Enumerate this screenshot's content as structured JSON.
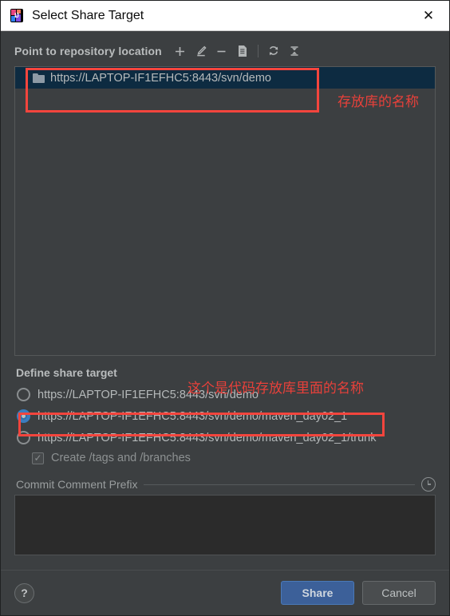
{
  "window": {
    "title": "Select Share Target",
    "app_icon": "intellij-idea-icon",
    "close_label": "✕"
  },
  "repository_section": {
    "label": "Point to repository location",
    "toolbar": [
      {
        "name": "add-location-button",
        "glyph": "+",
        "title": "Add"
      },
      {
        "name": "edit-location-button",
        "glyph": "edit",
        "title": "Edit"
      },
      {
        "name": "remove-location-button",
        "glyph": "−",
        "title": "Remove"
      },
      {
        "name": "copy-location-button",
        "glyph": "copy",
        "title": "Copy"
      },
      {
        "name": "refresh-button",
        "glyph": "refresh",
        "title": "Refresh"
      },
      {
        "name": "collapse-all-button",
        "glyph": "collapse",
        "title": "Collapse All"
      }
    ],
    "tree_items": [
      {
        "label": "https://LAPTOP-IF1EFHC5:8443/svn/demo",
        "icon": "folder-icon",
        "selected": true
      }
    ]
  },
  "share_target": {
    "title": "Define share target",
    "options": [
      {
        "label": "https://LAPTOP-IF1EFHC5:8443/svn/demo",
        "selected": false
      },
      {
        "label": "https://LAPTOP-IF1EFHC5:8443/svn/demo/maven_day02_1",
        "selected": true
      },
      {
        "label": "https://LAPTOP-IF1EFHC5:8443/svn/demo/maven_day02_1/trunk",
        "selected": false
      }
    ],
    "checkbox": {
      "label": "Create /tags and /branches",
      "checked": true,
      "enabled": false,
      "mark": "✓"
    }
  },
  "commit_prefix": {
    "title": "Commit Comment Prefix",
    "history_icon": "clock-icon",
    "value": "",
    "placeholder": ""
  },
  "footer": {
    "help_label": "?",
    "share_label": "Share",
    "cancel_label": "Cancel"
  },
  "annotations": [
    {
      "name": "annotation-repository-name",
      "text": "存放库的名称"
    },
    {
      "name": "annotation-project-name",
      "text": "这个是代码存放库里面的名称"
    }
  ],
  "colors": {
    "accent": "#3c6099",
    "annotation": "#f4453d",
    "selection": "#0d2b41",
    "background": "#3c3f41"
  }
}
